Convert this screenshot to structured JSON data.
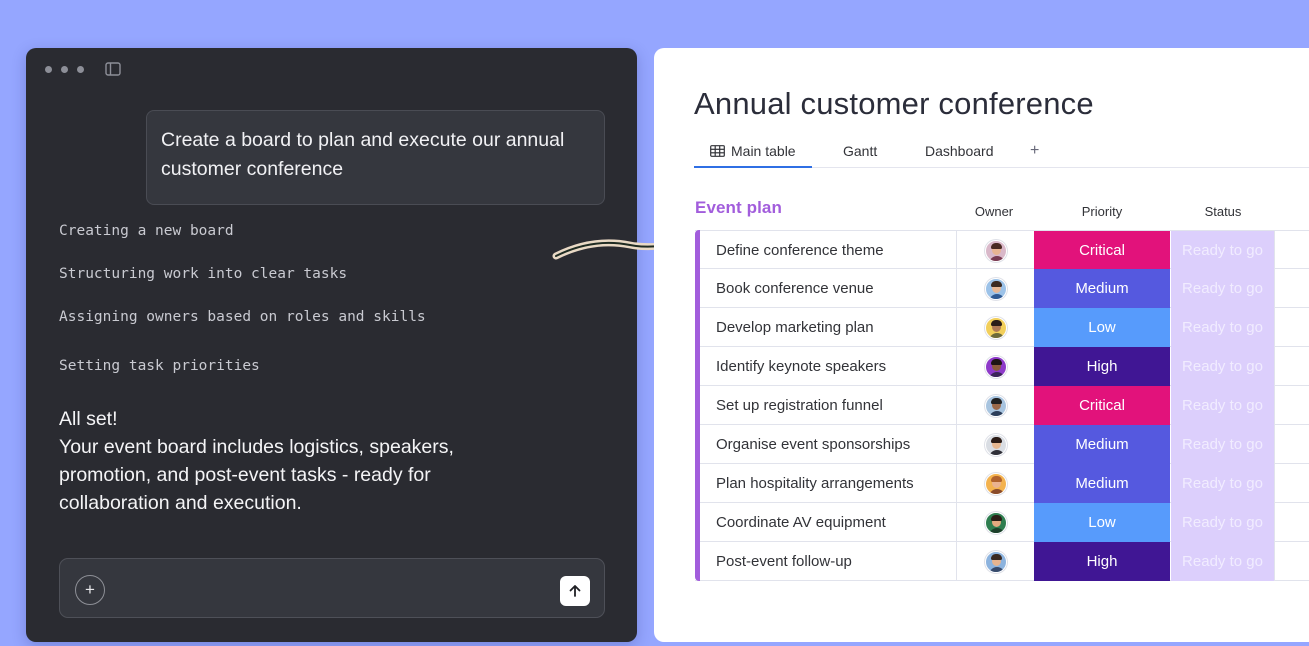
{
  "chat": {
    "prompt": "Create a board to plan and execute our annual customer conference",
    "steps": [
      "Creating a new board",
      "Structuring work into clear tasks",
      "Assigning owners based on roles and skills",
      "Setting task priorities"
    ],
    "done_title": "All set!",
    "done_body": "Your event board includes logistics, speakers, promotion, and post-event tasks - ready for collaboration and execution.",
    "composer": {
      "plus_icon": "+",
      "send_icon": "arrow-up-icon"
    }
  },
  "board": {
    "title": "Annual customer conference",
    "tabs": [
      {
        "label": "Main table",
        "icon": "table-icon",
        "active": true
      },
      {
        "label": "Gantt",
        "active": false
      },
      {
        "label": "Dashboard",
        "active": false
      }
    ],
    "add_tab": "+",
    "group": {
      "title": "Event plan",
      "color": "#a25ddc"
    },
    "columns": {
      "owner": "Owner",
      "priority": "Priority",
      "status": "Status"
    },
    "rows": [
      {
        "name": "Define conference theme",
        "priority": "Critical",
        "status": "Ready to go",
        "avatar": {
          "bg": "#d9b8c9",
          "hair": "#4a2a22",
          "skin": "#e8b492",
          "shirt": "#7a3b52"
        }
      },
      {
        "name": "Book conference venue",
        "priority": "Medium",
        "status": "Ready to go",
        "avatar": {
          "bg": "#9cc2e8",
          "hair": "#3a2a22",
          "skin": "#e7b896",
          "shirt": "#2f5a94"
        }
      },
      {
        "name": "Develop marketing plan",
        "priority": "Low",
        "status": "Ready to go",
        "avatar": {
          "bg": "#f2cf5b",
          "hair": "#2a1d18",
          "skin": "#b07a55",
          "shirt": "#6d6a3a"
        }
      },
      {
        "name": "Identify keynote speakers",
        "priority": "High",
        "status": "Ready to go",
        "avatar": {
          "bg": "#8e3ac9",
          "hair": "#1d1414",
          "skin": "#8b5a3d",
          "shirt": "#3a2458"
        }
      },
      {
        "name": "Set up registration funnel",
        "priority": "Critical",
        "status": "Ready to go",
        "avatar": {
          "bg": "#a8c4df",
          "hair": "#222222",
          "skin": "#9d6a4a",
          "shirt": "#2c3e5a"
        }
      },
      {
        "name": "Organise event sponsorships",
        "priority": "Medium",
        "status": "Ready to go",
        "avatar": {
          "bg": "#d9dde3",
          "hair": "#2a1b16",
          "skin": "#e6b791",
          "shirt": "#2f2f38"
        }
      },
      {
        "name": "Plan hospitality arrangements",
        "priority": "Medium",
        "status": "Ready to go",
        "avatar": {
          "bg": "#f3b24e",
          "hair": "#b0622d",
          "skin": "#eab290",
          "shirt": "#8a4b2b"
        }
      },
      {
        "name": "Coordinate AV equipment",
        "priority": "Low",
        "status": "Ready to go",
        "avatar": {
          "bg": "#2e7d4f",
          "hair": "#2a1d16",
          "skin": "#e3a97f",
          "shirt": "#1c3f2a"
        }
      },
      {
        "name": "Post-event follow-up",
        "priority": "High",
        "status": "Ready to go",
        "avatar": {
          "bg": "#8cb3de",
          "hair": "#3a2a22",
          "skin": "#e7b48f",
          "shirt": "#374a6b"
        }
      }
    ],
    "priority_colors": {
      "Critical": "#e2127b",
      "Medium": "#5559df",
      "Low": "#579bfc",
      "High": "#401694"
    }
  }
}
